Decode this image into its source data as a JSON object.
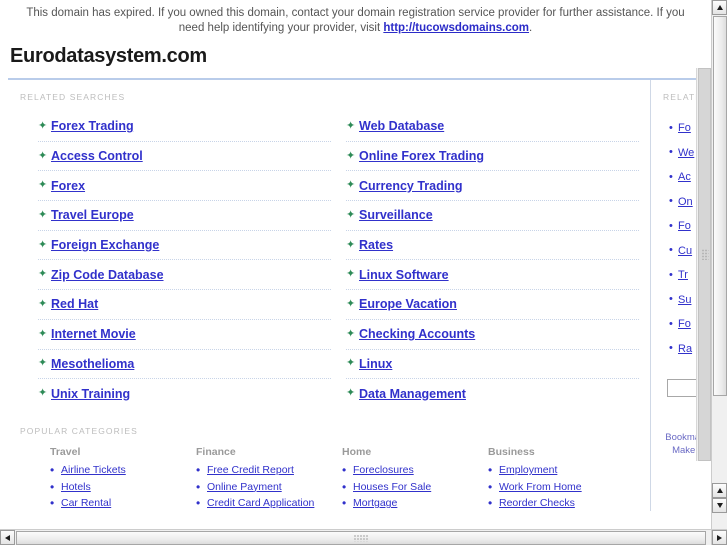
{
  "banner": {
    "text_before": "This domain has expired. If you owned this domain, contact your domain registration service provider for further assistance. If you need help identifying your provider, visit ",
    "link_text": "http://tucowsdomains.com",
    "text_after": "."
  },
  "header": {
    "domain_title": "Eurodatasystem.com"
  },
  "related_searches": {
    "label": "RELATED SEARCHES",
    "bullet_icon": "green-arrow-bullet",
    "left_column": [
      "Forex Trading",
      "Access Control",
      "Forex",
      "Travel Europe",
      "Foreign Exchange",
      "Zip Code Database",
      "Red Hat",
      "Internet Movie",
      "Mesothelioma",
      "Unix Training"
    ],
    "right_column": [
      "Web Database",
      "Online Forex Trading",
      "Currency Trading",
      "Surveillance",
      "Rates",
      "Linux Software",
      "Europe Vacation",
      "Checking Accounts",
      "Linux",
      "Data Management"
    ]
  },
  "popular_categories": {
    "label": "POPULAR CATEGORIES",
    "columns": [
      {
        "heading": "Travel",
        "items": [
          "Airline Tickets",
          "Hotels",
          "Car Rental"
        ]
      },
      {
        "heading": "Finance",
        "items": [
          "Free Credit Report",
          "Online Payment",
          "Credit Card Application"
        ]
      },
      {
        "heading": "Home",
        "items": [
          "Foreclosures",
          "Houses For Sale",
          "Mortgage"
        ]
      },
      {
        "heading": "Business",
        "items": [
          "Employment",
          "Work From Home",
          "Reorder Checks"
        ]
      }
    ]
  },
  "sidebar": {
    "label": "RELATED",
    "bullet_icon": "blue-square-bullet",
    "items": [
      "Fo",
      "We",
      "Ac",
      "On",
      "Fo",
      "Cu",
      "Tr",
      "Su",
      "Fo",
      "Ra"
    ],
    "search_value": "",
    "search_placeholder": "",
    "footer_lines": [
      "Bookmark",
      "Make thi"
    ]
  },
  "scrollbars": {
    "inner_vertical_icon": "vertical-scrollbar",
    "outer_up_icon": "scroll-up-arrow",
    "outer_down_icon": "scroll-down-arrow",
    "h_left_icon": "scroll-left-arrow",
    "h_right_icon": "scroll-right-arrow"
  },
  "colors": {
    "link": "#3131cb",
    "arrow": "#2e8b57",
    "section_label": "#bdbdbd",
    "rule": "#b9ccea"
  }
}
